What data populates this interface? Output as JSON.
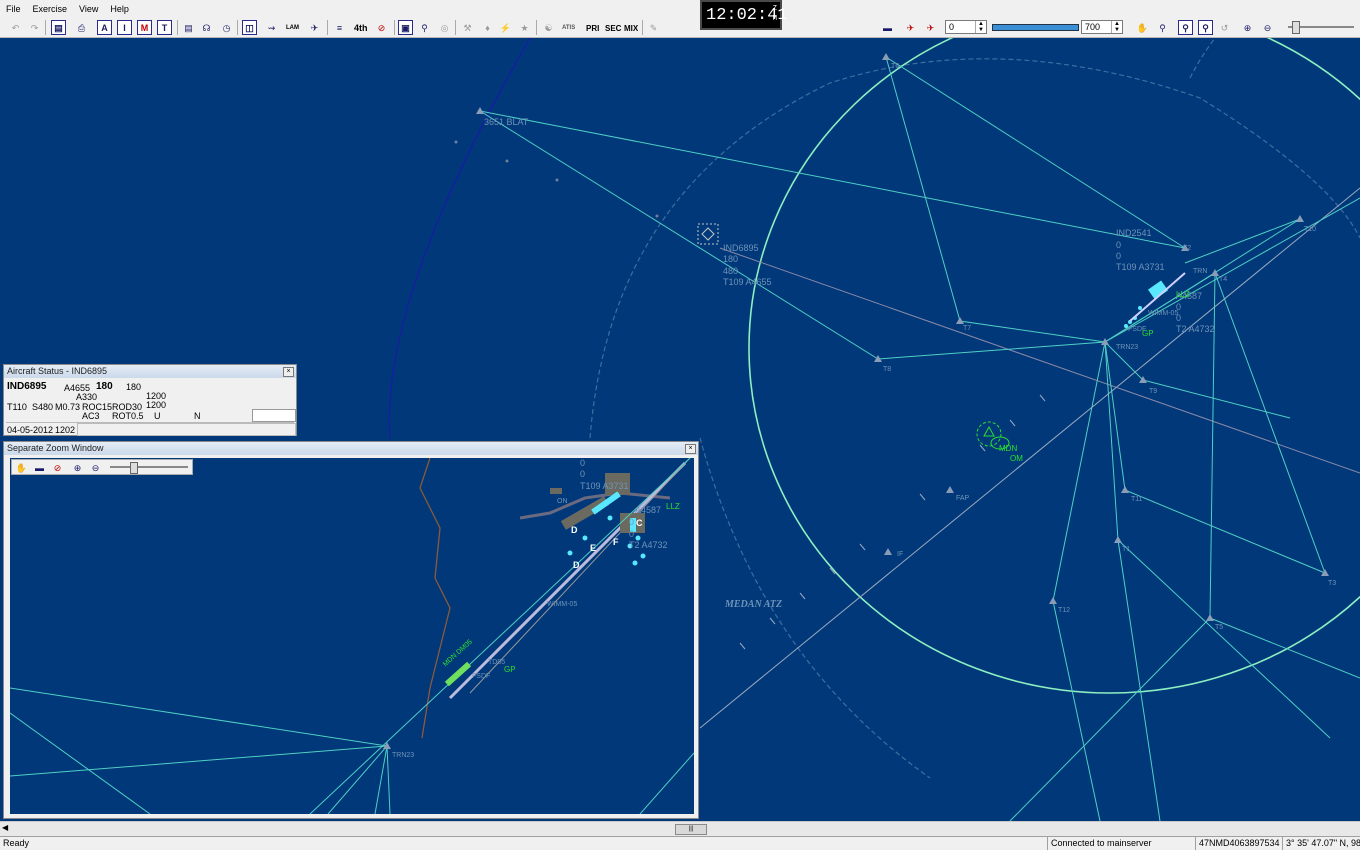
{
  "menu": [
    "File",
    "Exercise",
    "View",
    "Help"
  ],
  "toolbar": {
    "text_buttons": {
      "a": "A",
      "i": "I",
      "m": "M",
      "t": "T",
      "fourth": "4th",
      "atis": "ATIS",
      "pri": "PRI",
      "sec": "SEC",
      "mix": "MIX",
      "lam": "LAM"
    },
    "alt_min": "0",
    "alt_max": "700"
  },
  "clock": {
    "time": "12:02:41",
    "zone_top": "Z",
    "zone_bottom": "M"
  },
  "aircraft_status": {
    "title": "Aircraft Status - IND6895",
    "callsign": "IND6895",
    "assigned_alt": "A4655",
    "cleared_level": "180",
    "level2": "180",
    "type": "A330",
    "val_1200a": "1200",
    "val_1200b": "1200",
    "track": "T110",
    "speed": "S480",
    "mach": "M0.73",
    "roc": "ROC15",
    "rod": "ROD30",
    "ac": "AC3",
    "rot": "ROT0.5",
    "u": "U",
    "n": "N",
    "date": "04-05-2012",
    "time": "1202"
  },
  "zoom_window": {
    "title": "Separate Zoom Window",
    "labels": {
      "z0a": "0",
      "z0b": "0",
      "z0c": "0",
      "z0d": "0",
      "zt109": "T109 A3731",
      "za4587": "A4587",
      "zt2": "T2 A4732",
      "zc": "C",
      "zd": "D",
      "ze": "E",
      "zf": "F",
      "zdbox": "D",
      "zllz": "LLZ",
      "zwimm": "WIMM-05",
      "zfsdf": "FSDF",
      "ztd": "TD05",
      "zgp": "GP",
      "zmdn": "MDN DM05",
      "ztrn": "TRN23",
      "zon": "ON"
    }
  },
  "radar": {
    "labels": {
      "blat": "3651 BLAT",
      "ind6895": "IND6895",
      "v180": "180",
      "v480": "480",
      "t109a4655": "T109 A4655",
      "ind2541": "IND2541",
      "r0a": "0",
      "r0b": "0",
      "t109a3731": "T109 A3731",
      "a4587": "A4587",
      "r0c": "0",
      "r0d": "0",
      "t2a4732": "T2 A4732",
      "wimm": "WIMM-05",
      "trn23": "TRN23",
      "fsdf": "FSDF",
      "gp": "GP",
      "llz": "LLZ",
      "mdn": "MDN",
      "om": "OM",
      "fap": "FAP",
      "if": "IF",
      "atz": "MEDAN ATZ",
      "t1": "T1",
      "t2": "T2",
      "t3": "T3",
      "t4": "T4",
      "t5": "T5",
      "t6": "T6",
      "t7": "T7",
      "t8": "T8",
      "t9": "T9",
      "t10": "T10",
      "t11": "T11",
      "t12": "T12",
      "trn": "TRN"
    }
  },
  "statusbar": {
    "left": "Ready",
    "server": "Connected to mainserver",
    "id": "47NMD4063897534",
    "coord": "3° 35' 47.07\" N, 98°"
  },
  "colors": {
    "radar_bg": "#00387a",
    "route": "#4fd0c4",
    "atz_circle": "#8cf0c0",
    "label": "#6f93b6",
    "highlight": "#59e8ff",
    "green": "#2be12b"
  }
}
